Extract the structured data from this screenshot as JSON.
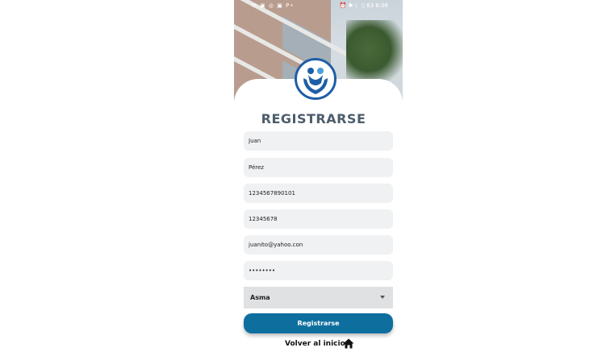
{
  "status_bar": {
    "left_icons": "✉ ▣ ◎ ▣ P•",
    "right_icons": "⏰ ✱ ☾ ▯ 83",
    "time": "6:08"
  },
  "page": {
    "title": "REGISTRARSE"
  },
  "form": {
    "first_name": "Juan",
    "last_name": "Pérez",
    "id_number": "1234567890101",
    "phone": "12345678",
    "email": "juanito@yahoo.con",
    "password": "••••••••",
    "condition": "Asma"
  },
  "actions": {
    "register_label": "Registrarse",
    "back_label": "Volver al inicio"
  },
  "icons": {
    "logo": "care-hands-logo",
    "home": "home-icon"
  },
  "colors": {
    "primary": "#0e6f9f",
    "title": "#4d5d6c",
    "field_bg": "#f0f1f2",
    "logo_blue": "#1d5fa6"
  }
}
